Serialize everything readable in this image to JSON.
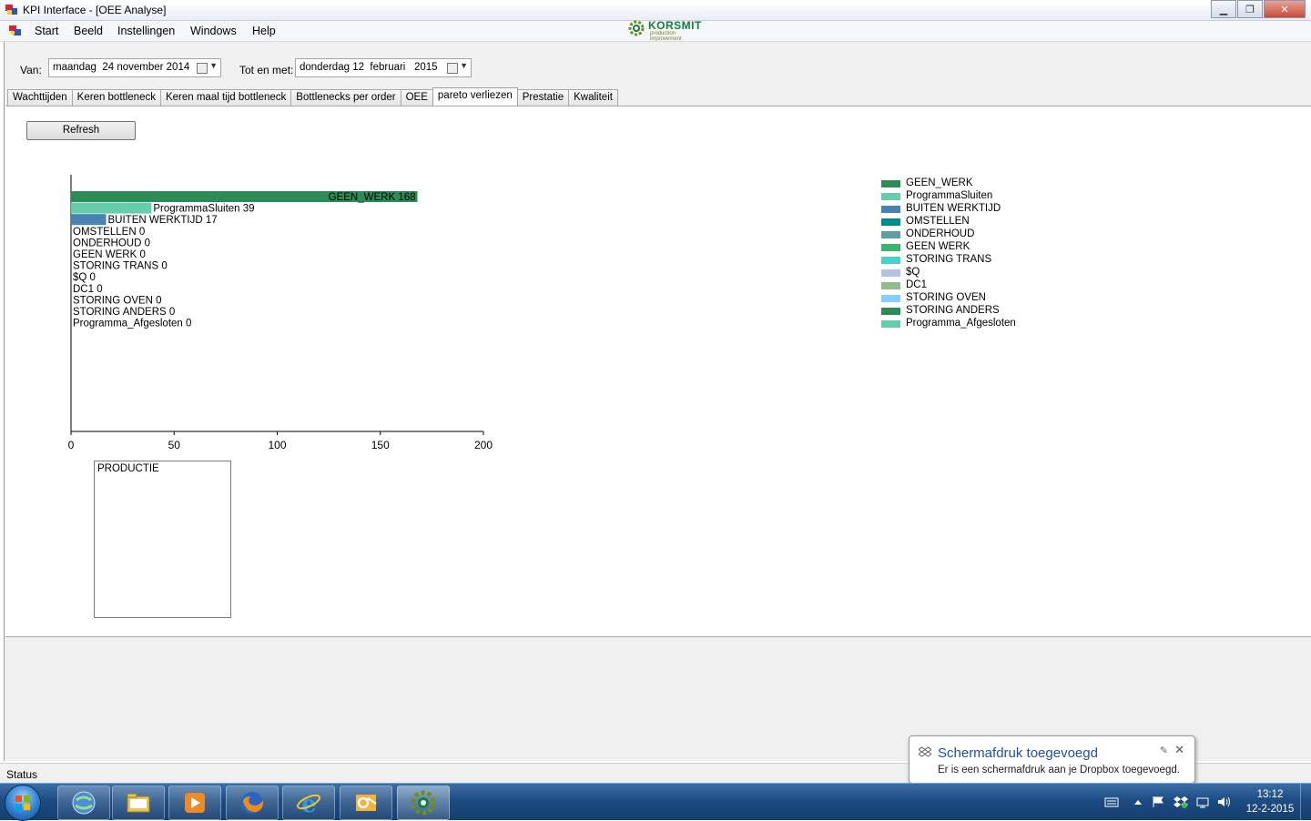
{
  "window": {
    "title": "KPI Interface - [OEE Analyse]",
    "minimize": "▁",
    "maximize": "❐",
    "close": "✕"
  },
  "menu": {
    "items": [
      "Start",
      "Beeld",
      "Instellingen",
      "Windows",
      "Help"
    ]
  },
  "logo": {
    "brand": "KORSMIT",
    "tagline": "production improvement"
  },
  "mdi_controls": {
    "minimize": "▁",
    "restore": "❐",
    "close": "✕"
  },
  "filters": {
    "van_label": "Van:",
    "van_value": "maandag  24 november 2014",
    "tot_label": "Tot en met:",
    "tot_value": "donderdag 12  februari   2015"
  },
  "tabs": [
    {
      "label": "Wachttijden",
      "active": false
    },
    {
      "label": "Keren bottleneck",
      "active": false
    },
    {
      "label": "Keren maal tijd bottleneck",
      "active": false
    },
    {
      "label": "Bottlenecks per order",
      "active": false
    },
    {
      "label": "OEE",
      "active": false
    },
    {
      "label": "pareto verliezen",
      "active": true
    },
    {
      "label": "Prestatie",
      "active": false
    },
    {
      "label": "Kwaliteit",
      "active": false
    }
  ],
  "refresh_label": "Refresh",
  "chart_data": {
    "type": "bar",
    "orientation": "horizontal",
    "categories": [
      "GEEN_WERK",
      "ProgrammaSluiten",
      "BUITEN WERKTIJD",
      "OMSTELLEN",
      "ONDERHOUD",
      "GEEN WERK",
      "STORING TRANS",
      "$Q",
      "DC1",
      "STORING OVEN",
      "STORING ANDERS",
      "Programma_Afgesloten"
    ],
    "values": [
      168,
      39,
      17,
      0,
      0,
      0,
      0,
      0,
      0,
      0,
      0,
      0
    ],
    "colors": [
      "#2e8b57",
      "#66cdaa",
      "#4682b4",
      "#008b8b",
      "#5f9ea0",
      "#3cb371",
      "#48d1cc",
      "#b0c4de",
      "#8fbc8f",
      "#87cefa",
      "#2e8b57",
      "#66cdaa"
    ],
    "xticks": [
      0,
      50,
      100,
      150,
      200
    ],
    "xlim": [
      0,
      200
    ],
    "legend_position": "right"
  },
  "production_box": {
    "label": "PRODUCTIE"
  },
  "status": {
    "text": "Status"
  },
  "toast": {
    "title": "Schermafdruk toegevoegd",
    "body": "Er is een schermafdruk aan je Dropbox toegevoegd."
  },
  "clock": {
    "time": "13:12",
    "date": "12-2-2015"
  }
}
